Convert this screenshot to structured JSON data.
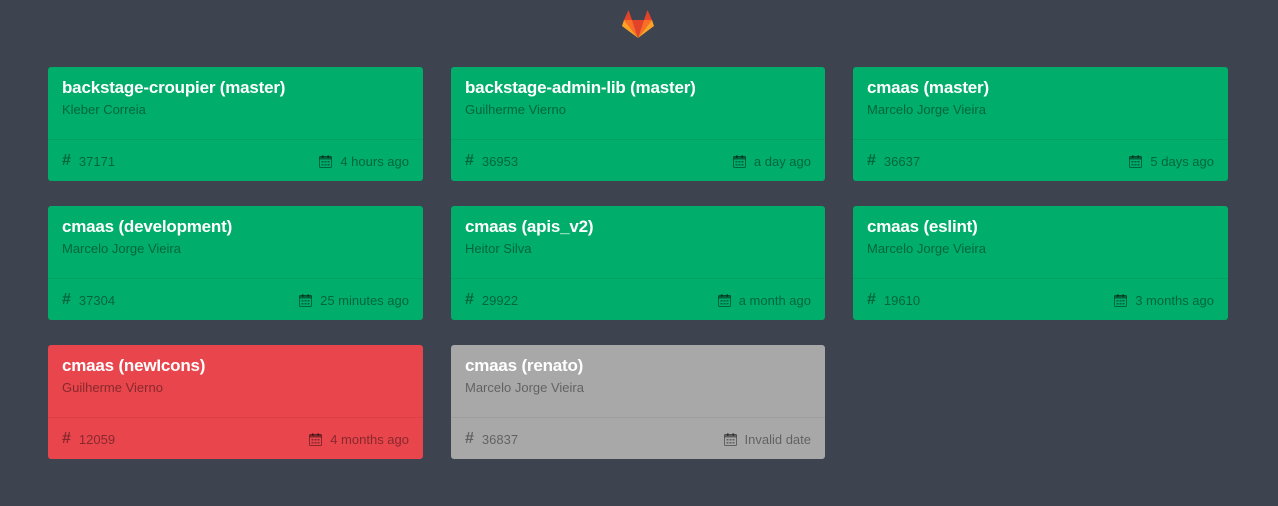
{
  "header": {
    "logo_icon": "gitlab-tanuki-icon"
  },
  "colors": {
    "background": "#3d444f",
    "success": "#00ad6b",
    "failed": "#e8454c",
    "canceled": "#a8a8a8"
  },
  "pipelines": [
    {
      "title": "backstage-croupier (master)",
      "author": "Kleber Correia",
      "id": "37171",
      "time": "4 hours ago",
      "status": "success"
    },
    {
      "title": "backstage-admin-lib (master)",
      "author": "Guilherme Vierno",
      "id": "36953",
      "time": "a day ago",
      "status": "success"
    },
    {
      "title": "cmaas (master)",
      "author": "Marcelo Jorge Vieira",
      "id": "36637",
      "time": "5 days ago",
      "status": "success"
    },
    {
      "title": "cmaas (development)",
      "author": "Marcelo Jorge Vieira",
      "id": "37304",
      "time": "25 minutes ago",
      "status": "success"
    },
    {
      "title": "cmaas (apis_v2)",
      "author": "Heitor Silva",
      "id": "29922",
      "time": "a month ago",
      "status": "success"
    },
    {
      "title": "cmaas (eslint)",
      "author": "Marcelo Jorge Vieira",
      "id": "19610",
      "time": "3 months ago",
      "status": "success"
    },
    {
      "title": "cmaas (newIcons)",
      "author": "Guilherme Vierno",
      "id": "12059",
      "time": "4 months ago",
      "status": "failed"
    },
    {
      "title": "cmaas (renato)",
      "author": "Marcelo Jorge Vieira",
      "id": "36837",
      "time": "Invalid date",
      "status": "canceled"
    }
  ]
}
